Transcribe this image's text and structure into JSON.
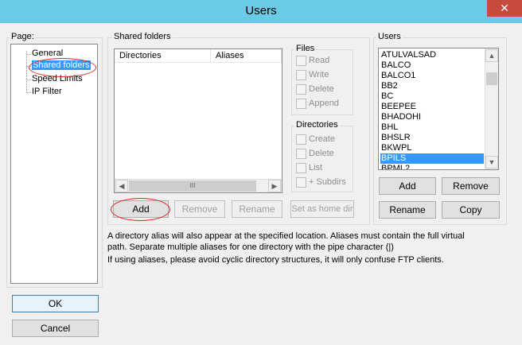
{
  "window": {
    "title": "Users",
    "close_glyph": "✕"
  },
  "page_group": {
    "label": "Page:",
    "items": [
      "General",
      "Shared folders",
      "Speed Limits",
      "IP Filter"
    ],
    "selected": "Shared folders"
  },
  "shared_folders": {
    "group_label": "Shared folders",
    "columns": [
      "Directories",
      "Aliases"
    ],
    "scroll_thumb": "III",
    "buttons": {
      "add": "Add",
      "remove": "Remove",
      "rename": "Rename",
      "set_home": "Set as home dir"
    }
  },
  "files_group": {
    "label": "Files",
    "options": [
      "Read",
      "Write",
      "Delete",
      "Append"
    ]
  },
  "directories_group": {
    "label": "Directories",
    "options": [
      "Create",
      "Delete",
      "List",
      "+ Subdirs"
    ]
  },
  "users_group": {
    "label": "Users",
    "items": [
      "ATULVALSAD",
      "BALCO",
      "BALCO1",
      "BB2",
      "BC",
      "BEEPEE",
      "BHADOHI",
      "BHL",
      "BHSLR",
      "BKWPL",
      "BPILS",
      "BPML2"
    ],
    "selected": "BPILS",
    "buttons": {
      "add": "Add",
      "remove": "Remove",
      "rename": "Rename",
      "copy": "Copy"
    }
  },
  "notes": {
    "line1": "A directory alias will also appear at the specified location. Aliases must contain the full virtual",
    "line2": "path. Separate multiple aliases for one directory with the pipe character (|)",
    "line3": "If using aliases, please avoid cyclic directory structures, it will only confuse FTP clients."
  },
  "footer": {
    "ok": "OK",
    "cancel": "Cancel"
  },
  "colors": {
    "titlebar": "#6bcae6",
    "close": "#c74a3f",
    "selection": "#3399ff",
    "annotation": "#d9261c"
  }
}
